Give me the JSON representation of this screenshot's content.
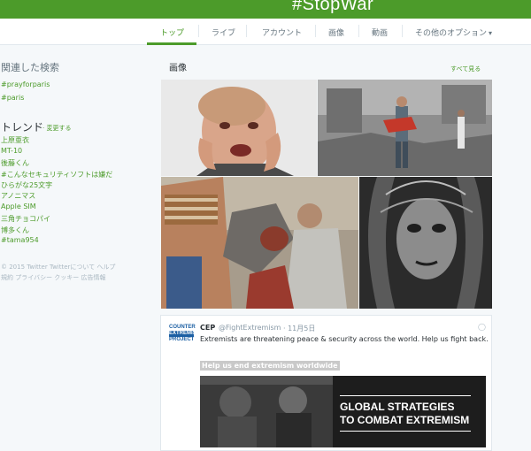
{
  "header": {
    "title": "#StopWar"
  },
  "nav": {
    "tabs": [
      {
        "label": "トップ"
      },
      {
        "label": "ライブ"
      },
      {
        "label": "アカウント"
      },
      {
        "label": "画像"
      },
      {
        "label": "動画"
      },
      {
        "label": "その他のオプション",
        "icon": "chevron-down-icon"
      }
    ]
  },
  "sidebar": {
    "related_title": "関連した検索",
    "related": [
      "#prayforparis",
      "#paris"
    ],
    "trends_title": "トレンド",
    "trends_change": "· 変更する",
    "trends": [
      "上原亜衣",
      "MT-10",
      "後藤くん",
      "#こんなセキュリティソフトは嫌だ",
      "ひらがな25文字",
      "アノニマス",
      "Apple SIM",
      "三角チョコパイ",
      "博多くん",
      "#tama954"
    ],
    "footer": {
      "line1": "© 2015 Twitter   Twitterについて   ヘルプ",
      "line2": "規約   プライバシー   クッキー   広告情報"
    }
  },
  "main": {
    "images_title": "画像",
    "see_all": "すべて見る"
  },
  "tweet": {
    "avatar_text": [
      "COUNTER",
      "EXTREMISM",
      "PROJECT"
    ],
    "name": "CEP",
    "handle": "@FightExtremism",
    "time": "· 11月5日",
    "text": "Extremists are threatening peace & security across the world. Help us fight back.",
    "card_title": "Help us end extremism worldwide",
    "card_heading_1": "GLOBAL STRATEGIES",
    "card_heading_2": "TO COMBAT EXTREMISM"
  },
  "colors": {
    "accent": "#4c9b2a",
    "background": "#f5f8fa"
  }
}
